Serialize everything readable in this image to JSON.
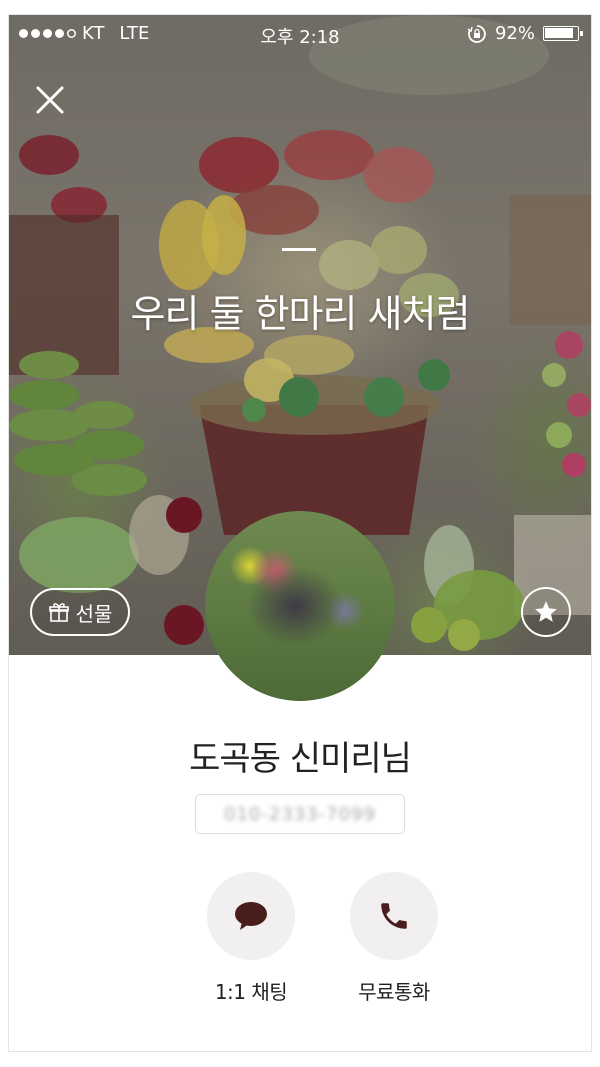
{
  "status_bar": {
    "carrier": "KT",
    "network": "LTE",
    "time": "오후 2:18",
    "battery_text": "92%",
    "battery_level": 0.92
  },
  "cover": {
    "profile_message": "우리 둘 한마리 새처럼"
  },
  "buttons": {
    "gift_label": "선물"
  },
  "profile": {
    "name": "도곡동 신미리님",
    "phone": "010-2333-7099"
  },
  "actions": [
    {
      "label": "1:1 채팅",
      "icon": "speech-bubble-icon"
    },
    {
      "label": "무료통화",
      "icon": "phone-icon"
    }
  ],
  "colors": {
    "icon_dark": "#4a1d1d",
    "action_circle": "#f1efef"
  }
}
